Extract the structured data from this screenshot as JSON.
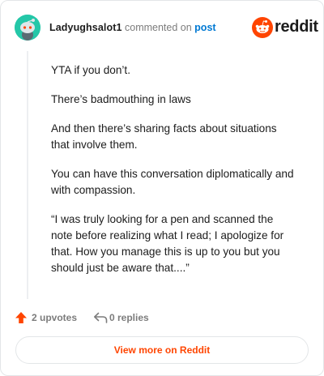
{
  "comment": {
    "author": "Ladyughsalot1",
    "commented_text": "commented on",
    "post_link": "post",
    "paragraphs": [
      "YTA if you don’t.",
      "There’s badmouthing in laws",
      "And then there’s sharing facts about situations that involve them.",
      "You can have this conversation diplomatically and with compassion.",
      "“I was truly looking for a pen and scanned the note before realizing what I read; I apologize for that. How you manage this is up to you but you should just be aware that....”"
    ]
  },
  "brand": {
    "name": "reddit",
    "icon": "reddit-logo-icon",
    "color": "#ff4500"
  },
  "actions": {
    "upvotes": "2 upvotes",
    "upvote_icon": "upvote-arrow-icon",
    "replies": "0 replies",
    "reply_icon": "reply-arrow-icon"
  },
  "footer": {
    "view_more_label": "View more on Reddit"
  },
  "colors": {
    "accent": "#ff4500",
    "link": "#0079d3",
    "avatar": "#24c7a8"
  }
}
